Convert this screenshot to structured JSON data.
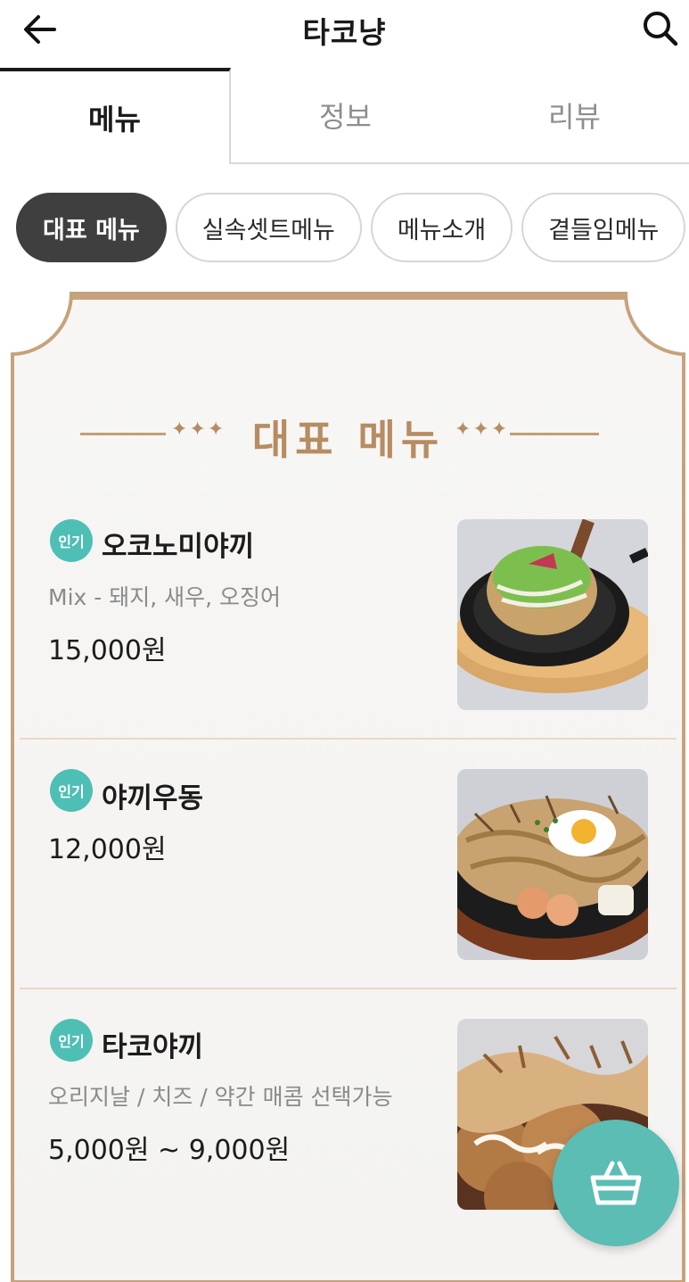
{
  "header": {
    "title": "타코냥",
    "back_icon": "arrow-left-icon",
    "search_icon": "search-icon"
  },
  "tabs": [
    {
      "label": "메뉴",
      "active": true
    },
    {
      "label": "정보",
      "active": false
    },
    {
      "label": "리뷰",
      "active": false
    }
  ],
  "chips": [
    {
      "label": "대표 메뉴",
      "active": true
    },
    {
      "label": "실속셋트메뉴",
      "active": false
    },
    {
      "label": "메뉴소개",
      "active": false
    },
    {
      "label": "곁들임메뉴",
      "active": false
    }
  ],
  "section": {
    "title": "대표 메뉴"
  },
  "items": [
    {
      "badge": "인기",
      "name": "오코노미야끼",
      "desc": "Mix - 돼지, 새우, 오징어",
      "price": "15,000원"
    },
    {
      "badge": "인기",
      "name": "야끼우동",
      "desc": "",
      "price": "12,000원"
    },
    {
      "badge": "인기",
      "name": "타코야끼",
      "desc": "오리지날 / 치즈 / 약간 매콤 선택가능",
      "price": "5,000원 ~ 9,000원"
    }
  ],
  "colors": {
    "accent_teal": "#5bbdb3",
    "gold": "#b68c62",
    "chip_active": "#3f3f3f"
  },
  "cart": {
    "icon": "shopping-basket-icon"
  }
}
